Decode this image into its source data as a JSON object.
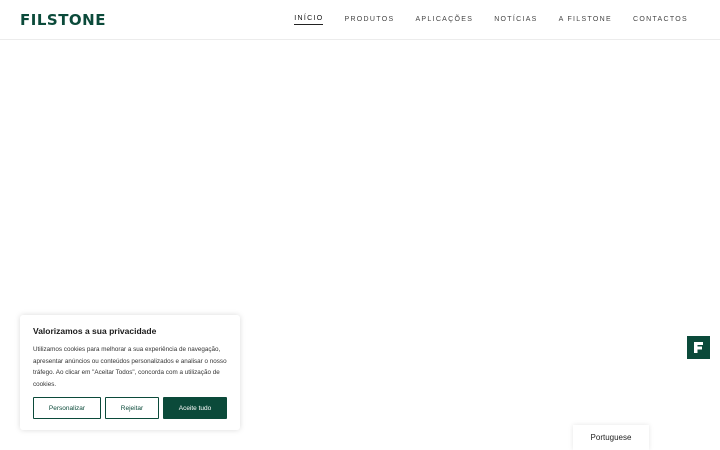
{
  "header": {
    "logo_text": "FILSTONE",
    "nav": [
      {
        "label": "INÍCIO",
        "active": true
      },
      {
        "label": "PRODUTOS",
        "active": false
      },
      {
        "label": "APLICAÇÕES",
        "active": false
      },
      {
        "label": "NOTÍCIAS",
        "active": false
      },
      {
        "label": "A FILSTONE",
        "active": false
      },
      {
        "label": "CONTACTOS",
        "active": false
      }
    ]
  },
  "cookie_banner": {
    "title": "Valorizamos a sua privacidade",
    "text": "Utilizamos cookies para melhorar a sua experiência de navegação, apresentar anúncios ou conteúdos personalizados e analisar o nosso tráfego. Ao clicar em \"Aceitar Todos\", concorda com a utilização de cookies.",
    "customize_label": "Personalizar",
    "reject_label": "Rejeitar",
    "accept_label": "Aceite tudo"
  },
  "side_badge": {
    "icon": "filstone-f-icon"
  },
  "language": {
    "label": "Portuguese"
  },
  "colors": {
    "brand": "#0b4a3a",
    "background": "#ffffff"
  }
}
